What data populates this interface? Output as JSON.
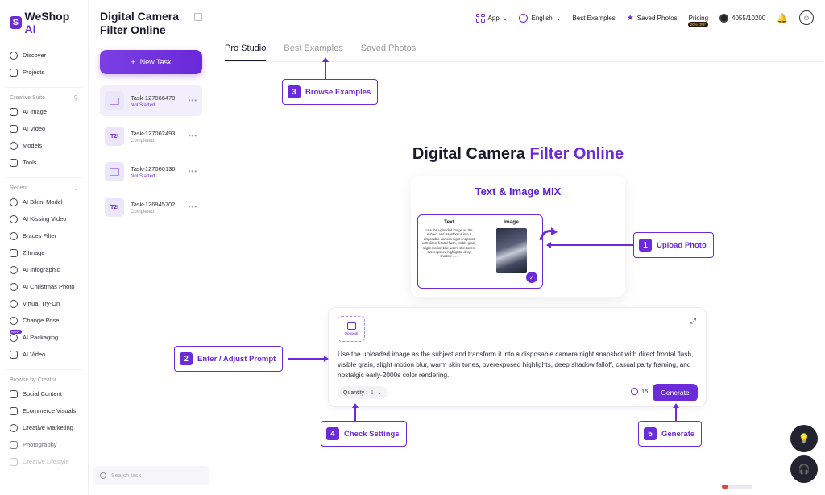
{
  "brand": {
    "logo_letter": "S",
    "name_main": "WeShop ",
    "name_ai": "AI"
  },
  "leftnav": {
    "top_items": [
      {
        "label": "Discover"
      },
      {
        "label": "Projects"
      }
    ],
    "creative_suite": {
      "title": "Creative Suite",
      "items": [
        {
          "label": "AI Image"
        },
        {
          "label": "AI Video"
        },
        {
          "label": "Models"
        },
        {
          "label": "Tools"
        }
      ]
    },
    "recent": {
      "title": "Recent",
      "items": [
        {
          "label": "AI Bikini Model"
        },
        {
          "label": "AI Kissing Video"
        },
        {
          "label": "Braces Filter"
        },
        {
          "label": "Z Image"
        },
        {
          "label": "AI Infographic"
        },
        {
          "label": "AI Christmas Photo"
        },
        {
          "label": "Virtual Try-On"
        },
        {
          "label": "Change Pose"
        },
        {
          "label": "AI Packaging",
          "badge": "NEW"
        },
        {
          "label": "AI Video"
        }
      ]
    },
    "creator": {
      "title": "Browse by Creator",
      "items": [
        {
          "label": "Social Content"
        },
        {
          "label": "Ecommerce Visuals"
        },
        {
          "label": "Creative Marketing"
        },
        {
          "label": "Photography"
        },
        {
          "label": "Creative Lifestyle"
        }
      ]
    }
  },
  "taskpanel": {
    "title": "Digital Camera Filter Online",
    "new_task": "New Task",
    "tasks": [
      {
        "name": "Task-127066470",
        "status": "Not Started",
        "thumb": ""
      },
      {
        "name": "Task-127062493",
        "status": "Completed",
        "thumb": "T2I"
      },
      {
        "name": "Task-127060136",
        "status": "Not Started",
        "thumb": ""
      },
      {
        "name": "Task-126945702",
        "status": "Completed",
        "thumb": "T2I"
      }
    ],
    "search_placeholder": "Search task"
  },
  "topbar": {
    "app": "App",
    "language": "English",
    "best_examples": "Best Examples",
    "saved_photos": "Saved Photos",
    "pricing": "Pricing",
    "pricing_badge": "20% OFF",
    "credits": "4055/10200"
  },
  "tabs": [
    {
      "label": "Pro Studio"
    },
    {
      "label": "Best Examples"
    },
    {
      "label": "Saved Photos"
    }
  ],
  "hero": {
    "part1": "Digital Camera ",
    "part2": "Filter Online"
  },
  "mix_card": {
    "title": "Text & Image MIX",
    "text_header": "Text",
    "image_header": "Image",
    "text_body": "Use the uploaded image as the subject and transform it into a disposable camera night snapshot with direct frontal flash, visible grain, slight motion blur, warm skin tones, overexposed highlights, deep shadow ......"
  },
  "prompt": {
    "optional": "Optional",
    "text": "Use the uploaded image as the subject and transform it into a disposable camera night snapshot with direct frontal flash, visible grain, slight motion blur, warm skin tones, overexposed highlights, deep shadow falloff, casual party framing, and nostalgic early-2000s color rendering.",
    "quantity_label": "Quantity :",
    "quantity_value": "1",
    "cost": "15",
    "generate": "Generate"
  },
  "annotations": [
    {
      "num": "1",
      "label": "Upload Photo"
    },
    {
      "num": "2",
      "label": "Enter / Adjust Prompt"
    },
    {
      "num": "3",
      "label": "Browse Examples"
    },
    {
      "num": "4",
      "label": "Check Settings"
    },
    {
      "num": "5",
      "label": "Generate"
    }
  ],
  "colors": {
    "accent": "#6c2bd9",
    "text": "#1a1a2e"
  }
}
